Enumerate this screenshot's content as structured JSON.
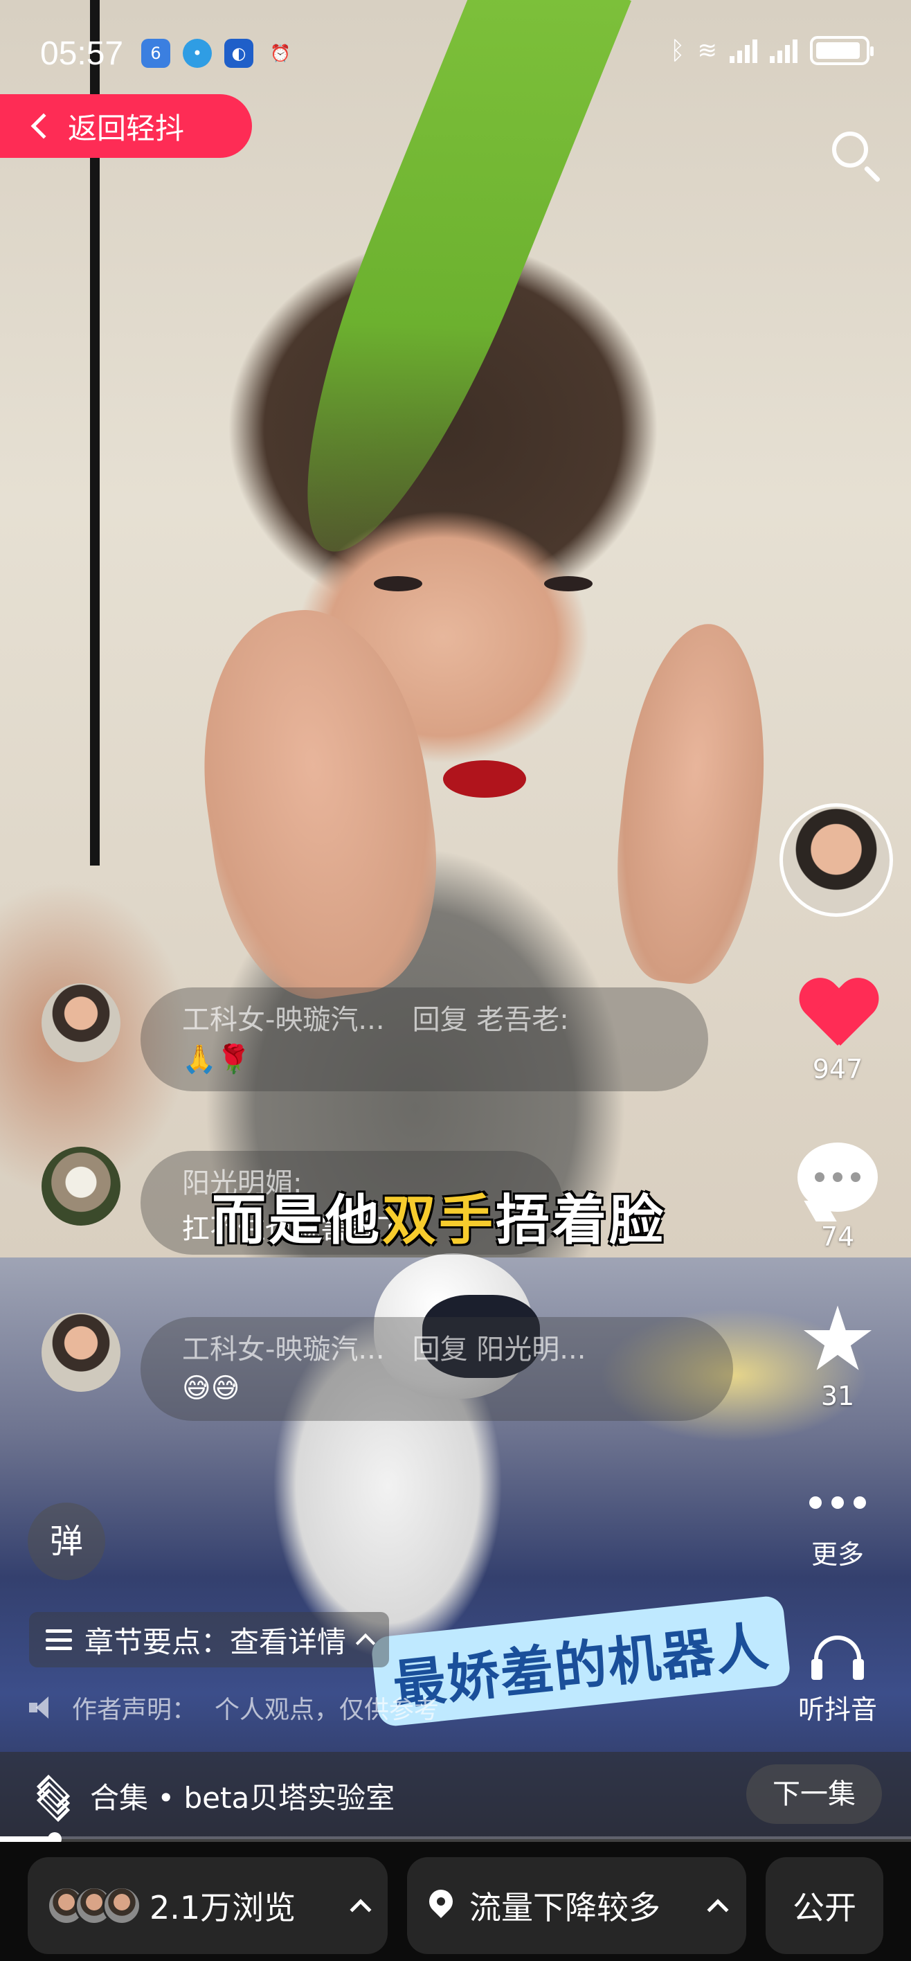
{
  "status_bar": {
    "time": "05:57",
    "network_label": "6"
  },
  "header": {
    "back_label": "返回轻抖"
  },
  "video": {
    "subtitle_prefix": "而是他",
    "subtitle_highlight": "双手",
    "subtitle_suffix": "捂着脸",
    "sticker_text": "最娇羞的机器人"
  },
  "comments": [
    {
      "author": "工科女-映璇汽...",
      "reply": "回复 老吾老:",
      "body": "🙏🌹"
    },
    {
      "author": "阳光明媚:",
      "reply": "",
      "body": "扛不住也就害羞了。"
    },
    {
      "author": "工科女-映璇汽...",
      "reply": "回复 阳光明...",
      "body": "😅😅"
    }
  ],
  "actions": {
    "likes": "947",
    "comments": "74",
    "favorites": "31",
    "more_label": "更多",
    "listen_label": "听抖音"
  },
  "danmu": {
    "label": "弹"
  },
  "chapter": {
    "label": "章节要点：查看详情"
  },
  "disclaimer": {
    "label": "作者声明：",
    "text": "个人观点，仅供参考"
  },
  "collection": {
    "label": "合集 • beta贝塔实验室",
    "next_label": "下一集"
  },
  "playback": {
    "progress": 0.06
  },
  "stats": {
    "views": "2.1万浏览",
    "traffic": "流量下降较多",
    "visibility": "公开"
  },
  "colors": {
    "accent": "#fe2c55",
    "subtitle_highlight": "#f7cc2d"
  }
}
